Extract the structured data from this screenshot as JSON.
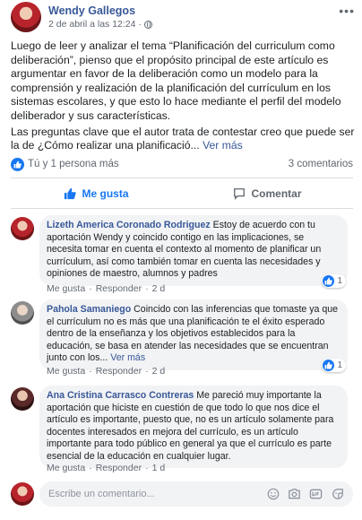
{
  "post": {
    "author": "Wendy Gallegos",
    "timestamp": "2 de abril a las 12:24 ·",
    "paragraphs": [
      "Luego de leer y analizar el tema “Planificación del curriculum como deliberación”, pienso que el propósito principal de este artículo es argumentar en favor de la deliberación como un modelo para la comprensión y realización de la planificación del currículum en los sistemas escolares, y que esto lo hace mediante el perfil del modelo deliberador y sus características.",
      "Las preguntas clave que el autor trata de contestar creo que puede ser la de ¿Cómo realizar una planificació..."
    ],
    "see_more": "Ver más",
    "reactions_text": "Tú y 1 persona más",
    "comments_count": "3 comentarios",
    "like_label": "Me gusta",
    "comment_label": "Comentar"
  },
  "comments": [
    {
      "author": "Lizeth America Coronado Rodriguez",
      "text": "Estoy de acuerdo con tu aportación Wendy y coincido contigo en las implicaciones, se necesita tomar en cuenta el contexto al momento de planificar un currículum, así como también tomar en cuenta las necesidades y opiniones de maestro, alumnos y padres",
      "see_more": "",
      "like": "Me gusta",
      "reply": "Responder",
      "age": "2 d",
      "reaction_count": "1"
    },
    {
      "author": "Pahola Samaniego",
      "text": "Coincido con las inferencias que tomaste ya que el currículum no es más que una planificación te el éxito esperado dentro de la enseñanza y los objetivos establecidos para la educación, se basa en atender las necesidades que se encuentran junto con los...",
      "see_more": "Ver más",
      "like": "Me gusta",
      "reply": "Responder",
      "age": "2 d",
      "reaction_count": "1"
    },
    {
      "author": "Ana Cristina Carrasco Contreras",
      "text": "Me pareció muy importante la aportación que hiciste en cuestión de que todo lo que nos dice el artículo es importante, puesto que, no es un artículo solamente para docentes interesados en mejora del currículo, es un artículo importante para todo público en general ya que el currículo es parte esencial de la educación en cualquier lugar.",
      "see_more": "",
      "like": "Me gusta",
      "reply": "Responder",
      "age": "1 d",
      "reaction_count": ""
    }
  ],
  "composer": {
    "placeholder": "Escribe un comentario...",
    "icons": [
      "emoji-icon",
      "camera-icon",
      "gif-icon",
      "sticker-icon"
    ]
  },
  "colors": {
    "link": "#385898",
    "accent": "#1877f2",
    "muted": "#606770",
    "bubble": "#f2f3f5"
  }
}
